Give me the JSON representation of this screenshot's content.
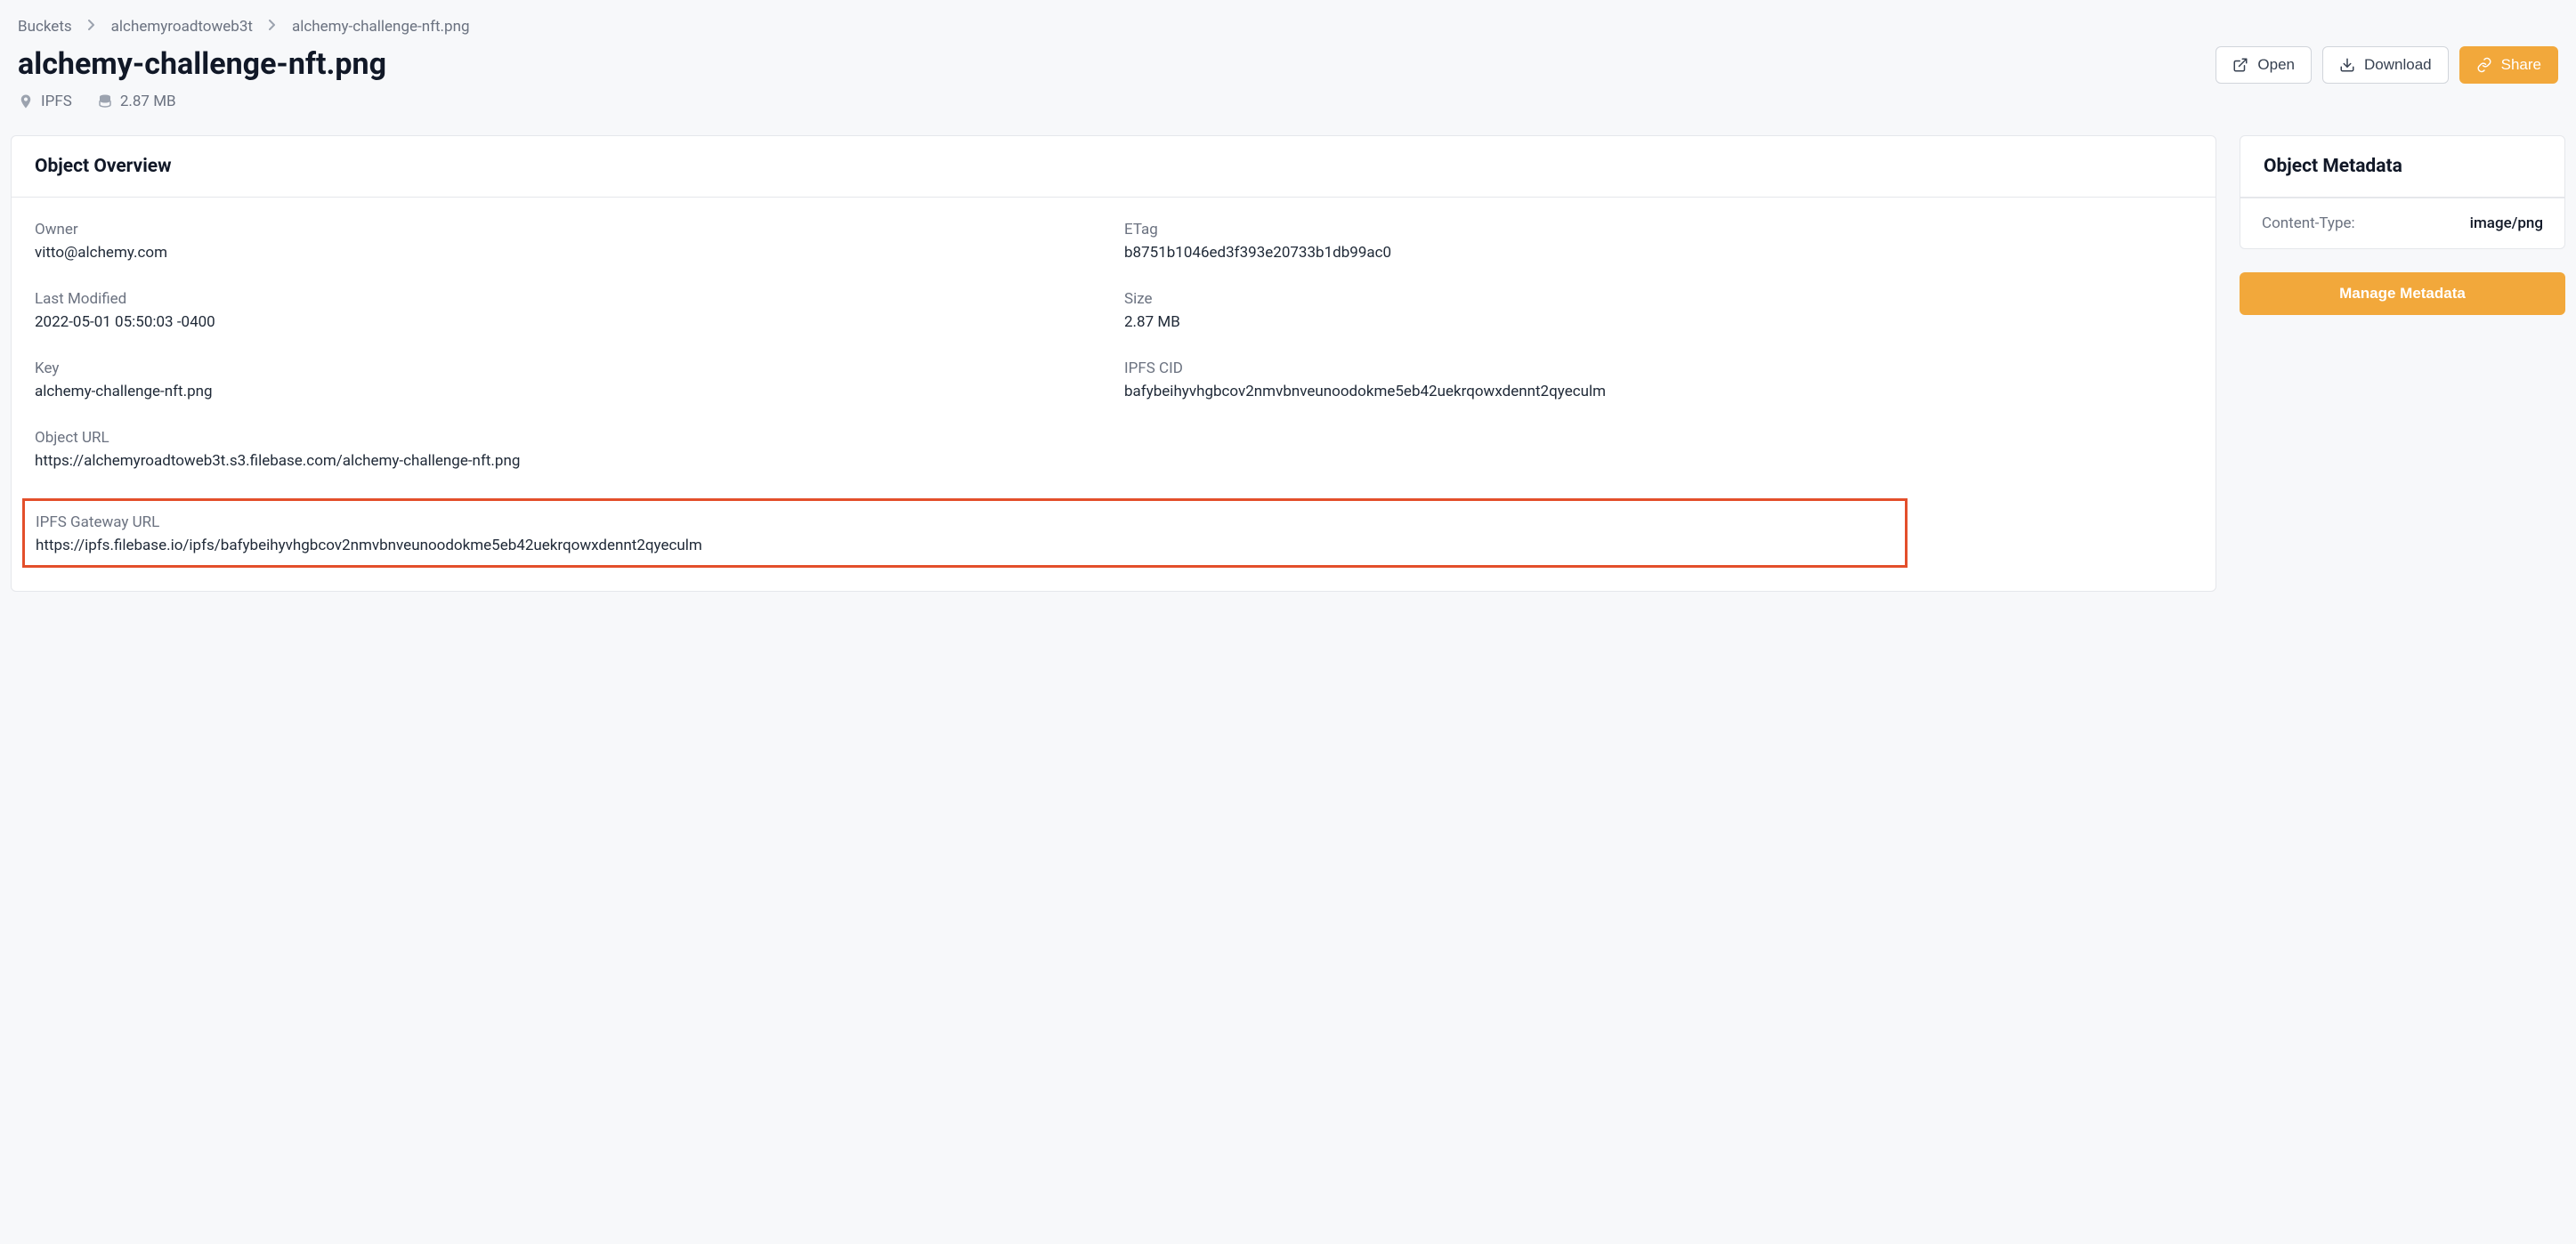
{
  "breadcrumb": {
    "root": "Buckets",
    "bucket": "alchemyroadtoweb3t",
    "object": "alchemy-challenge-nft.png"
  },
  "page_title": "alchemy-challenge-nft.png",
  "meta": {
    "network": "IPFS",
    "size": "2.87 MB"
  },
  "actions": {
    "open": "Open",
    "download": "Download",
    "share": "Share"
  },
  "overview": {
    "title": "Object Overview",
    "owner_label": "Owner",
    "owner_value": "vitto@alchemy.com",
    "etag_label": "ETag",
    "etag_value": "b8751b1046ed3f393e20733b1db99ac0",
    "last_modified_label": "Last Modified",
    "last_modified_value": "2022-05-01 05:50:03 -0400",
    "size_label": "Size",
    "size_value": "2.87 MB",
    "key_label": "Key",
    "key_value": "alchemy-challenge-nft.png",
    "cid_label": "IPFS CID",
    "cid_value": "bafybeihyvhgbcov2nmvbnveunoodokme5eb42uekrqowxdennt2qyeculm",
    "object_url_label": "Object URL",
    "object_url_value": "https://alchemyroadtoweb3t.s3.filebase.com/alchemy-challenge-nft.png",
    "gateway_url_label": "IPFS Gateway URL",
    "gateway_url_value": "https://ipfs.filebase.io/ipfs/bafybeihyvhgbcov2nmvbnveunoodokme5eb42uekrqowxdennt2qyeculm"
  },
  "metadata": {
    "title": "Object Metadata",
    "content_type_label": "Content-Type:",
    "content_type_value": "image/png",
    "manage_button": "Manage Metadata"
  }
}
